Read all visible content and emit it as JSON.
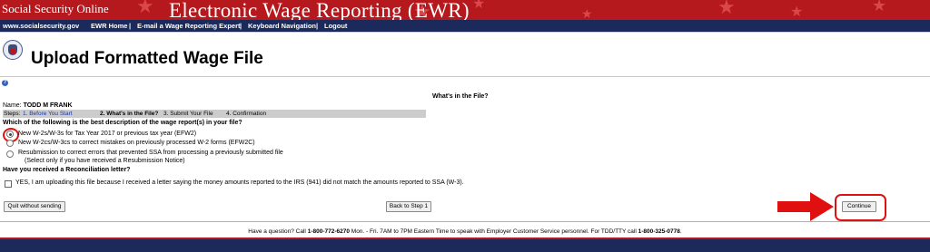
{
  "header": {
    "site_name": "Social Security Online",
    "title": "Electronic Wage Reporting (EWR)"
  },
  "nav": {
    "site": "www.socialsecurity.gov",
    "home": "EWR Home",
    "sep1": "|",
    "email": "E-mail a Wage Reporting Expert",
    "sep2": "|",
    "keyboard": "Keyboard Navigation",
    "sep3": "|",
    "logout": "Logout"
  },
  "page_title": "Upload Formatted Wage File",
  "section_heading": "What's in the File?",
  "user": {
    "name_label": "Name:",
    "name_value": "TODD M FRANK"
  },
  "steps": {
    "label": "Steps:",
    "step1": "1. Before You Start",
    "step2": "2. What's in the File?",
    "step3": "3. Submit Your File",
    "step4": "4. Confirmation"
  },
  "question1": "Which of the following is the best description of the wage report(s) in your file?",
  "options": [
    {
      "label": "New W-2s/W-3s for Tax Year 2017 or previous tax year (EFW2)",
      "selected": true
    },
    {
      "label": "New W-2cs/W-3cs to correct mistakes on previously processed W-2 forms (EFW2C)",
      "selected": false
    },
    {
      "label": "Resubmission to correct errors that prevented SSA from processing a previously submitted file",
      "note": "(Select only if you have received a Resubmission Notice)",
      "selected": false
    }
  ],
  "question2": "Have you received a Reconciliation letter?",
  "checkbox_label": "YES, I am uploading this file because I received a letter saying the money amounts reported to the IRS (941) did not match the amounts reported to SSA (W-3).",
  "buttons": {
    "quit": "Quit without sending",
    "back": "Back to Step 1",
    "continue": "Continue"
  },
  "footer": {
    "pre": "Have a question? Call",
    "phone": "1-800-772-6270",
    "mid": "Mon. - Fri. 7AM to 7PM Eastern Time to speak with Employer Customer Service personnel. For TDD/TTY call",
    "tty": "1-800-325-0778",
    "end": "."
  },
  "colors": {
    "banner_red": "#b5181d",
    "nav_blue": "#1b2a5a",
    "highlight_red": "#e01010"
  }
}
